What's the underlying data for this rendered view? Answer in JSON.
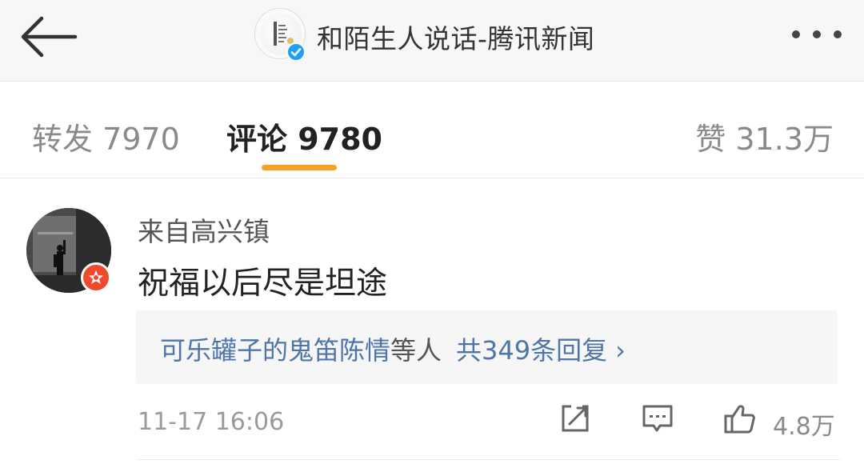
{
  "header": {
    "back_icon": "arrow-left-icon",
    "title": "和陌生人说话-腾讯新闻",
    "verified_icon": "verified-check-icon",
    "more_icon": "more-dots-icon",
    "accent": "#1da1f2"
  },
  "tabs": {
    "repost": "转发 7970",
    "comments": "评论 9780",
    "likes": "赞 31.3万",
    "active": "comments",
    "underline_color": "#f7a225"
  },
  "comment": {
    "username": "来自高兴镇",
    "text": "祝福以后尽是坦途",
    "replies": {
      "names": "可乐罐子的鬼笛陈情",
      "suffix": "等人",
      "count": "共349条回复",
      "chevron": "›"
    },
    "time": "11-17 16:06",
    "actions": {
      "share_icon": "share-icon",
      "reply_icon": "comment-icon",
      "like_icon": "thumbs-up-icon",
      "like_count": "4.8万"
    },
    "badge_color": "#f04a2d",
    "link_color": "#4f75a8"
  }
}
